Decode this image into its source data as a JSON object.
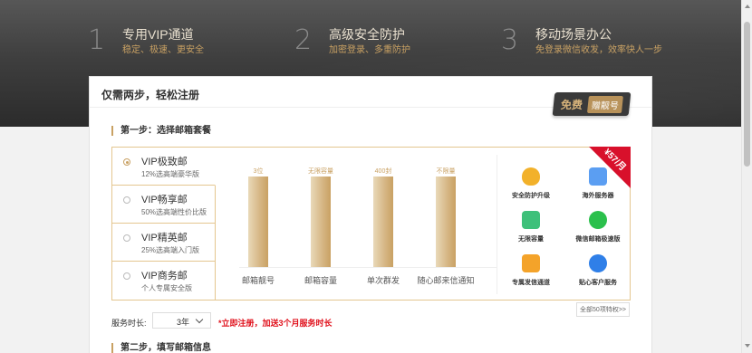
{
  "hero": {
    "features": [
      {
        "num": "1",
        "title": "专用VIP通道",
        "sub": "稳定、极速、更安全"
      },
      {
        "num": "2",
        "title": "高级安全防护",
        "sub": "加密登录、多重防护"
      },
      {
        "num": "3",
        "title": "移动场景办公",
        "sub": "免登录微信收发，效率快人一步"
      }
    ]
  },
  "card": {
    "title": "仅需两步，轻松注册",
    "free_tag": {
      "main": "免费",
      "sub": "赠靓号"
    },
    "step1": "第一步：选择邮箱套餐",
    "step2": "第二步，填写邮箱信息",
    "plans": [
      {
        "name": "VIP极致邮",
        "desc": "12%选高端豪华版",
        "selected": true
      },
      {
        "name": "VIP畅享邮",
        "desc": "50%选高端性价比版",
        "selected": false
      },
      {
        "name": "VIP精英邮",
        "desc": "25%选高端入门版",
        "selected": false
      },
      {
        "name": "VIP商务邮",
        "desc": "个人专属安全版",
        "selected": false
      }
    ],
    "ribbon_price": "¥57/月",
    "privileges": [
      {
        "icon": "shield-icon",
        "label": "安全防护升级"
      },
      {
        "icon": "server-icon",
        "label": "海外服务器"
      },
      {
        "icon": "battery-icon",
        "label": "无限容量"
      },
      {
        "icon": "wechat-icon",
        "label": "微信邮箱极速版"
      },
      {
        "icon": "mail-shield-icon",
        "label": "专属发信通道"
      },
      {
        "icon": "headset-icon",
        "label": "贴心客户服务"
      }
    ],
    "all_privileges_link": "全部50项特权>>",
    "duration_label": "服务时长:",
    "duration_value": "3年",
    "promo": "*立即注册，加送3个月服务时长",
    "accent": "#c9a163",
    "ribbon_color": "#d8102b"
  },
  "chart_data": {
    "type": "bar",
    "categories": [
      "邮箱靓号",
      "邮箱容量",
      "单次群发",
      "随心邮来信通知"
    ],
    "bar_labels": [
      "3位",
      "无限容量",
      "400封",
      "不限量"
    ],
    "values": [
      1,
      1,
      1,
      1
    ]
  }
}
